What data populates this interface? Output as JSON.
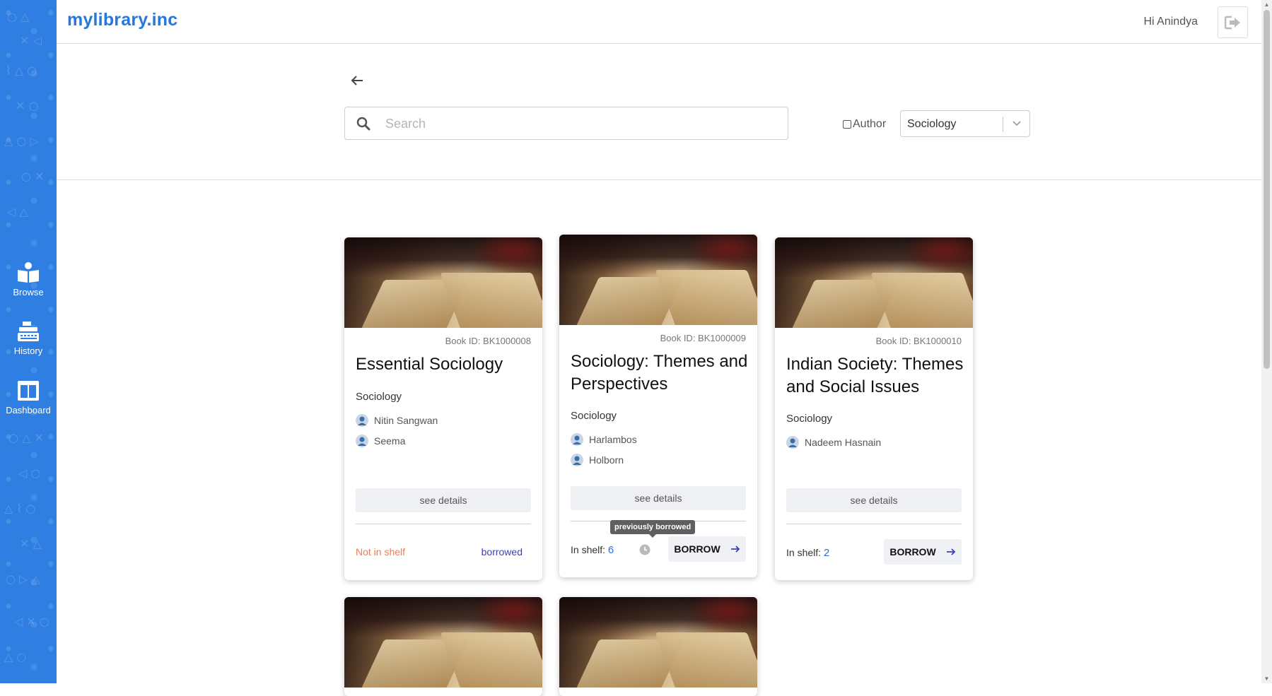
{
  "header": {
    "brand": "mylibrary.inc",
    "greeting": "Hi Anindya"
  },
  "sidebar": {
    "items": [
      {
        "label": "Browse",
        "icon": "book-icon"
      },
      {
        "label": "History",
        "icon": "register-icon"
      },
      {
        "label": "Dashboard",
        "icon": "dashboard-icon"
      }
    ]
  },
  "search": {
    "placeholder": "Search",
    "value": "",
    "author_label": "Author",
    "author_checked": false,
    "category_selected": "Sociology"
  },
  "cards": [
    {
      "book_id": "Book ID: BK1000008",
      "title": "Essential Sociology",
      "genre": "Sociology",
      "authors": [
        "Nitin Sangwan",
        "Seema"
      ],
      "details_label": "see details",
      "status": "Not in shelf",
      "status_right": "borrowed"
    },
    {
      "book_id": "Book ID: BK1000009",
      "title": "Sociology: Themes and Perspectives",
      "genre": "Sociology",
      "authors": [
        "Harlambos",
        "Holborn"
      ],
      "details_label": "see details",
      "in_shelf_label": "In shelf: ",
      "in_shelf_count": "6",
      "tooltip": "previously borrowed",
      "borrow_label": "BORROW"
    },
    {
      "book_id": "Book ID: BK1000010",
      "title": "Indian Society: Themes and Social Issues",
      "genre": "Sociology",
      "authors": [
        "Nadeem Hasnain"
      ],
      "details_label": "see details",
      "in_shelf_label": "In shelf: ",
      "in_shelf_count": "2",
      "borrow_label": "BORROW"
    }
  ],
  "colors": {
    "brand": "#2478df",
    "sidebar": "#2f7fe3",
    "not_in_shelf": "#f07a55",
    "borrowed": "#3b3fbf",
    "shelf_count": "#2a6fd6"
  }
}
